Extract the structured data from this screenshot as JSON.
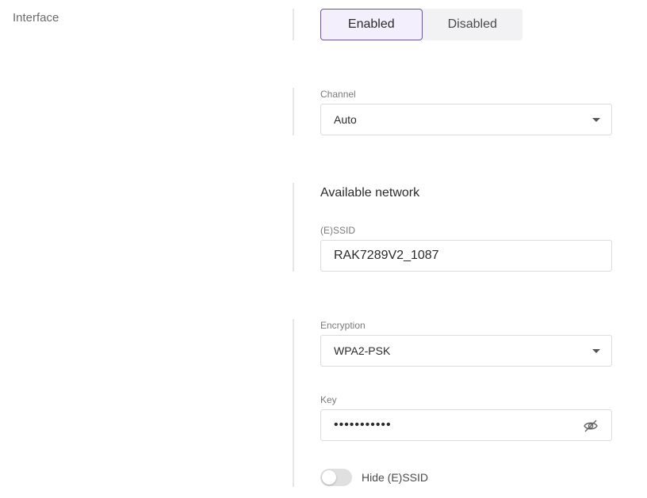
{
  "interface": {
    "label": "Interface",
    "options": [
      "Enabled",
      "Disabled"
    ],
    "selected": "Enabled"
  },
  "channel": {
    "label": "Channel",
    "value": "Auto"
  },
  "available_network": {
    "heading": "Available network",
    "essid_label": "(E)SSID",
    "essid_value": "RAK7289V2_1087"
  },
  "encryption": {
    "label": "Encryption",
    "value": "WPA2-PSK"
  },
  "key": {
    "label": "Key",
    "value": "•••••••••••",
    "visibility_icon": "eye-off-icon"
  },
  "hide_essid": {
    "label": "Hide (E)SSID",
    "on": false
  },
  "colors": {
    "accent": "#6e5a8c",
    "active_bg": "#f3effc"
  }
}
